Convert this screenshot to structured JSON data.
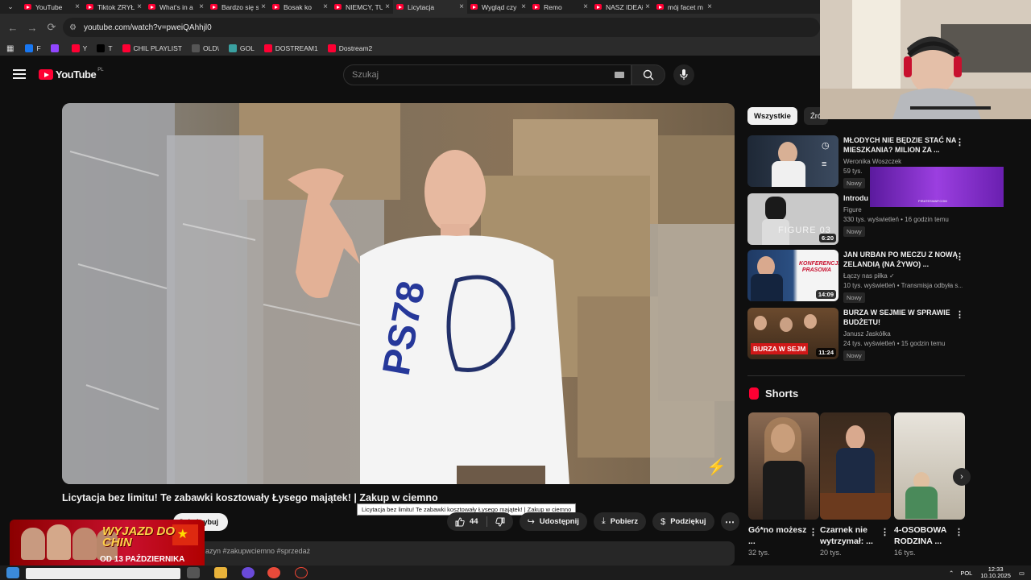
{
  "browser": {
    "tabs": [
      {
        "title": "YouTube",
        "active": false
      },
      {
        "title": "Tiktok ZRYŁ",
        "active": false
      },
      {
        "title": "What's in a",
        "active": false
      },
      {
        "title": "Bardzo się s",
        "active": false
      },
      {
        "title": "Bosak ko",
        "active": false
      },
      {
        "title": "NIEMCY, TU",
        "active": false
      },
      {
        "title": "Licytacja",
        "active": true
      },
      {
        "title": "Wygląd czy",
        "active": false
      },
      {
        "title": "Remo",
        "active": false
      },
      {
        "title": "NASZ IDEAŁ",
        "active": false
      },
      {
        "title": "mój facet m",
        "active": false
      }
    ],
    "url": "youtube.com/watch?v=pweiQAhhjl0",
    "bookmarks": [
      {
        "label": "F",
        "color": "#1877f2"
      },
      {
        "label": "",
        "color": "#9146ff"
      },
      {
        "label": "Y",
        "color": "#ff0033"
      },
      {
        "label": "T",
        "color": "#000000"
      },
      {
        "label": "CHIL PLAYLIST",
        "color": "#ff0033"
      },
      {
        "label": "OLD\\",
        "color": "#555555"
      },
      {
        "label": "GOL",
        "color": "#3aa0a0"
      },
      {
        "label": "DOSTREAM1",
        "color": "#ff0033"
      },
      {
        "label": "Dostream2",
        "color": "#ff0033"
      }
    ]
  },
  "youtube": {
    "logo_text": "YouTube",
    "country": "PL",
    "search_placeholder": "Szukaj"
  },
  "video": {
    "title": "Licytacja bez limitu! Te zabawki kosztowały Łysego majątek! | Zakup w ciemno",
    "tooltip": "Licytacja bez limitu! Te zabawki kosztowały Łysego majątek! | Zakup w ciemno",
    "subscribe_label": "Subskrybuj",
    "likes": "44",
    "share_label": "Udostępnij",
    "download_label": "Pobierz",
    "thanks_label": "Podziękuj",
    "description_snippet": "azyn #zakupwciemno #sprzedaż"
  },
  "promo": {
    "headline": "WYJAZD DO CHIN",
    "date": "OD 13 PAŹDZIERNIKA"
  },
  "sidebar": {
    "chips": [
      "Wszystkie",
      "Źró"
    ],
    "recommendations": [
      {
        "title": "MŁODYCH NIE BĘDZIE STAĆ NA MIESZKANIA? MILION ZA ...",
        "channel": "Weronika Woszczek",
        "meta": "59 tys.",
        "badge": "Nowy",
        "duration": ""
      },
      {
        "title": "Introdu",
        "channel": "Figure",
        "meta": "330 tys. wyświetleń • 16 godzin temu",
        "badge": "Nowy",
        "duration": "6:20",
        "thumb_text": "FIGURE 03"
      },
      {
        "title": "JAN URBAN PO MECZU Z NOWĄ ZELANDIĄ (NA ŻYWO) ...",
        "channel": "Łączy nas piłka",
        "meta": "10 tys. wyświetleń • Transmisja odbyła s...",
        "badge": "Nowy",
        "duration": "14:09",
        "thumb_text": "KONFERENCJA PRASOWA"
      },
      {
        "title": "BURZA W SEJMIE W SPRAWIE BUDŻETU!",
        "channel": "Janusz Jaskółka",
        "meta": "24 tys. wyświetleń • 15 godzin temu",
        "badge": "Nowy",
        "duration": "11:24",
        "thumb_text": "BURZA W SEJM"
      }
    ],
    "shorts_heading": "Shorts",
    "shorts": [
      {
        "title": "Gó*no możesz ...",
        "views": "32 tys."
      },
      {
        "title": "Czarnek nie wytrzymał: ...",
        "views": "20 tys."
      },
      {
        "title": "4-OSOBOWA RODZINA ...",
        "views": "16 tys."
      }
    ]
  },
  "ad": {
    "small_text": "PIRATESWAP.COM"
  },
  "taskbar": {
    "language": "POL",
    "time": "12:33",
    "date": "10.10.2025"
  }
}
